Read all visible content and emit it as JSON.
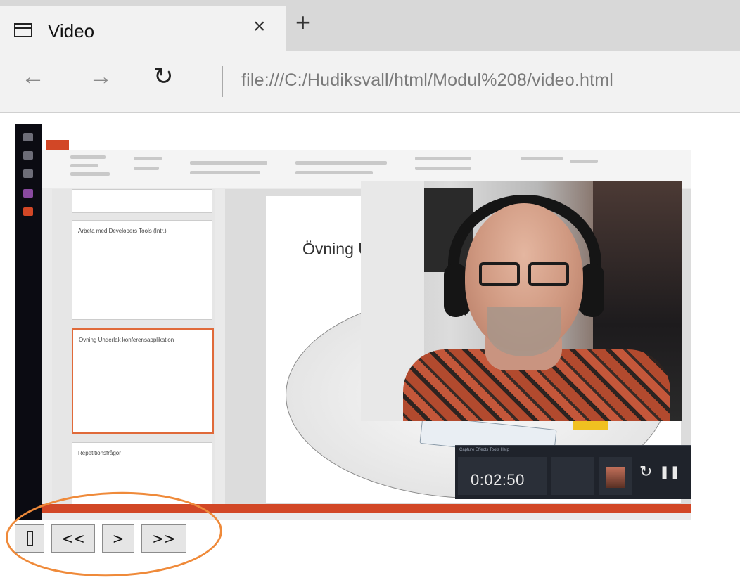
{
  "browser": {
    "tab": {
      "title": "Video",
      "icon": "tab-page-icon",
      "close_glyph": "×"
    },
    "new_tab_glyph": "+",
    "nav": {
      "back_glyph": "←",
      "forward_glyph": "→",
      "refresh_glyph": "↻"
    },
    "address": "file:///C:/Hudiksvall/html/Modul%208/video.html"
  },
  "video": {
    "slide_title": "Övning U",
    "thumb_titles": [
      "Arbeta med Developers Tools (Intr.)",
      "Övning Underlak konferensapplikation",
      "Repetitionsfrågor"
    ],
    "recorder": {
      "menu": "Capture   Effects   Tools   Help",
      "time": "0:02:50",
      "restart_glyph": "↻",
      "pause_glyph": "❚❚"
    },
    "colors": {
      "accent": "#d24726",
      "recorder_bg": "#1f232b"
    }
  },
  "controls": {
    "stop_label": "",
    "rewind_label": "<<",
    "play_label": ">",
    "forward_label": ">>"
  },
  "annotation": {
    "highlight_color": "#ef8a3a"
  }
}
